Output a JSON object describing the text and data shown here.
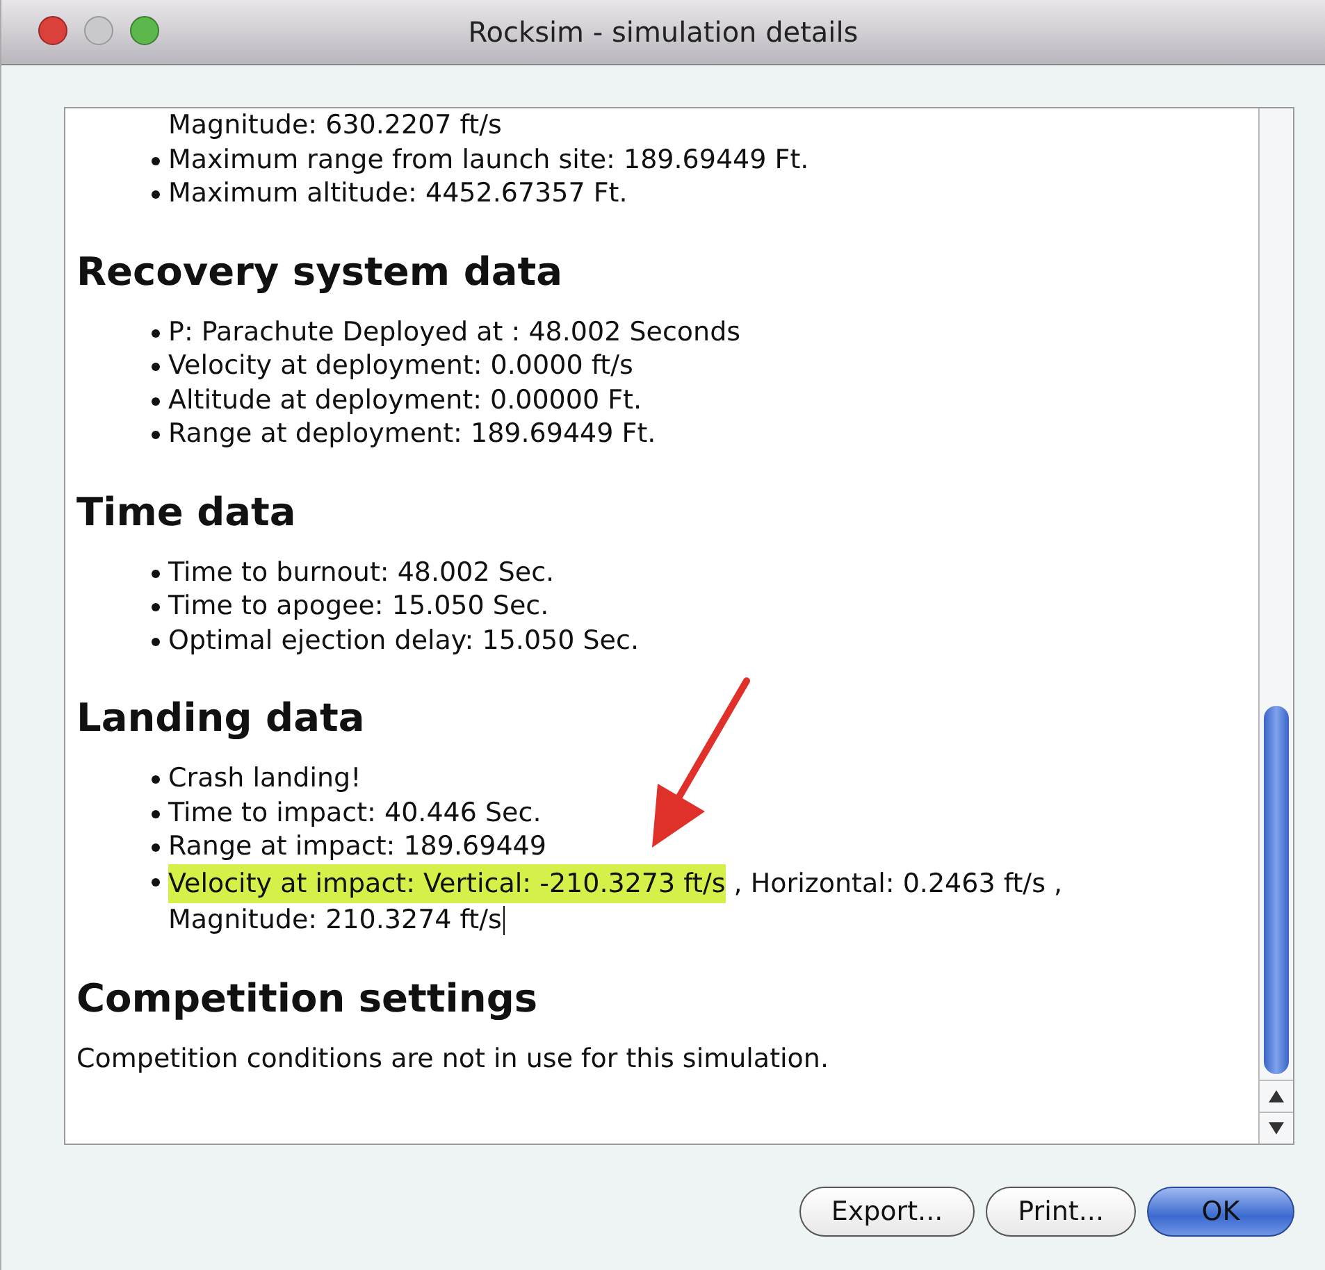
{
  "window": {
    "title": "Rocksim - simulation details"
  },
  "sections": [
    {
      "items": [
        {
          "kind": "continuation",
          "parts": [
            {
              "text": "Magnitude: 630.2207 ft/s",
              "highlighted": false
            }
          ]
        },
        {
          "kind": "bullet",
          "parts": [
            {
              "text": "Maximum range from launch site: 189.69449 Ft.",
              "highlighted": false
            }
          ]
        },
        {
          "kind": "bullet",
          "parts": [
            {
              "text": "Maximum altitude: 4452.67357 Ft.",
              "highlighted": false
            }
          ]
        }
      ]
    },
    {
      "heading": "Recovery system data",
      "items": [
        {
          "kind": "bullet",
          "parts": [
            {
              "text": "P: Parachute Deployed at : 48.002 Seconds",
              "highlighted": false
            }
          ]
        },
        {
          "kind": "bullet",
          "parts": [
            {
              "text": "Velocity at deployment: 0.0000 ft/s",
              "highlighted": false
            }
          ]
        },
        {
          "kind": "bullet",
          "parts": [
            {
              "text": "Altitude at deployment: 0.00000 Ft.",
              "highlighted": false
            }
          ]
        },
        {
          "kind": "bullet",
          "parts": [
            {
              "text": "Range at deployment: 189.69449 Ft.",
              "highlighted": false
            }
          ]
        }
      ]
    },
    {
      "heading": "Time data",
      "items": [
        {
          "kind": "bullet",
          "parts": [
            {
              "text": "Time to burnout: 48.002 Sec.",
              "highlighted": false
            }
          ]
        },
        {
          "kind": "bullet",
          "parts": [
            {
              "text": "Time to apogee: 15.050 Sec.",
              "highlighted": false
            }
          ]
        },
        {
          "kind": "bullet",
          "parts": [
            {
              "text": "Optimal ejection delay: 15.050 Sec.",
              "highlighted": false
            }
          ]
        }
      ]
    },
    {
      "heading": "Landing data",
      "items": [
        {
          "kind": "bullet",
          "parts": [
            {
              "text": "Crash landing!",
              "highlighted": false
            }
          ]
        },
        {
          "kind": "bullet",
          "parts": [
            {
              "text": "Time to impact: 40.446 Sec.",
              "highlighted": false
            }
          ]
        },
        {
          "kind": "bullet",
          "parts": [
            {
              "text": "Range at impact: 189.69449",
              "highlighted": false
            }
          ]
        },
        {
          "kind": "bullet",
          "parts": [
            {
              "text": "Velocity at impact: Vertical: -210.3273 ft/s",
              "highlighted": true
            },
            {
              "text": " , Horizontal: 0.2463 ft/s ,",
              "highlighted": false
            }
          ],
          "continuation": "Magnitude: 210.3274 ft/s",
          "cursor": true
        }
      ]
    },
    {
      "heading": "Competition settings",
      "items": [
        {
          "kind": "paragraph",
          "parts": [
            {
              "text": "Competition conditions are not in use for this simulation.",
              "highlighted": false
            }
          ]
        }
      ]
    }
  ],
  "buttons": [
    {
      "label": "Export...",
      "default": false
    },
    {
      "label": "Print...",
      "default": false
    },
    {
      "label": "OK",
      "default": true
    }
  ]
}
